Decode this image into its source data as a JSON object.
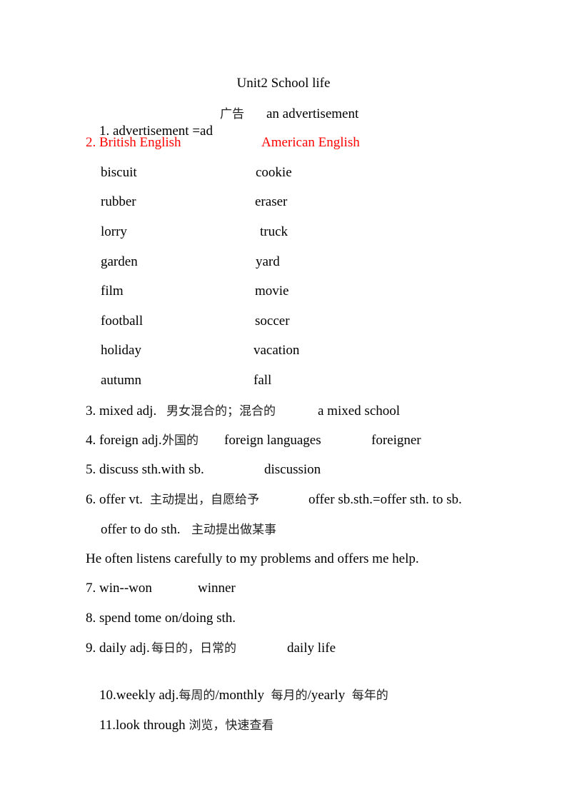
{
  "title": "Unit2 School life",
  "item1": {
    "term": "1. advertisement =ad",
    "cn": "广告",
    "example": "an advertisement"
  },
  "item2": {
    "left": "2. British English",
    "right": "American English"
  },
  "pairs": [
    {
      "british": "biscuit",
      "american": "cookie"
    },
    {
      "british": "rubber",
      "american": "eraser"
    },
    {
      "british": "lorry",
      "american": "truck"
    },
    {
      "british": "garden",
      "american": "yard"
    },
    {
      "british": "film",
      "american": "movie"
    },
    {
      "british": "football",
      "american": "soccer"
    },
    {
      "british": "holiday",
      "american": "vacation"
    },
    {
      "british": "autumn",
      "american": "fall"
    }
  ],
  "item3": {
    "term": "3. mixed adj.",
    "cn": "男女混合的；混合的",
    "example": "a mixed school"
  },
  "item4": {
    "term": "4. foreign adj.",
    "cn": "外国的",
    "example": "foreign languages",
    "extra": "foreigner"
  },
  "item5": {
    "term": "5. discuss sth.with sb.",
    "extra": "discussion"
  },
  "item6": {
    "term": "6. offer vt.",
    "cn": "主动提出，自愿给予",
    "example": "offer sb.sth.=offer sth. to sb.",
    "sub_term": "offer to do sth.",
    "sub_cn": "主动提出做某事"
  },
  "sentence": "He often listens carefully to my problems and offers me help.",
  "item7": {
    "term": "7. win--won",
    "extra": "winner"
  },
  "item8": {
    "term": "8. spend tome on/doing sth."
  },
  "item9": {
    "term": "9. daily adj.",
    "cn": "每日的，日常的",
    "example": "daily life"
  },
  "item10": {
    "a": "10.weekly adj.",
    "a_cn": "每周的",
    "b": "/monthly",
    "b_cn": "每月的",
    "c": "/yearly",
    "c_cn": "每年的"
  },
  "item11": {
    "term": "11.look through",
    "cn": "浏览，快速查看"
  },
  "colors": {
    "highlight": "#ff0000"
  }
}
